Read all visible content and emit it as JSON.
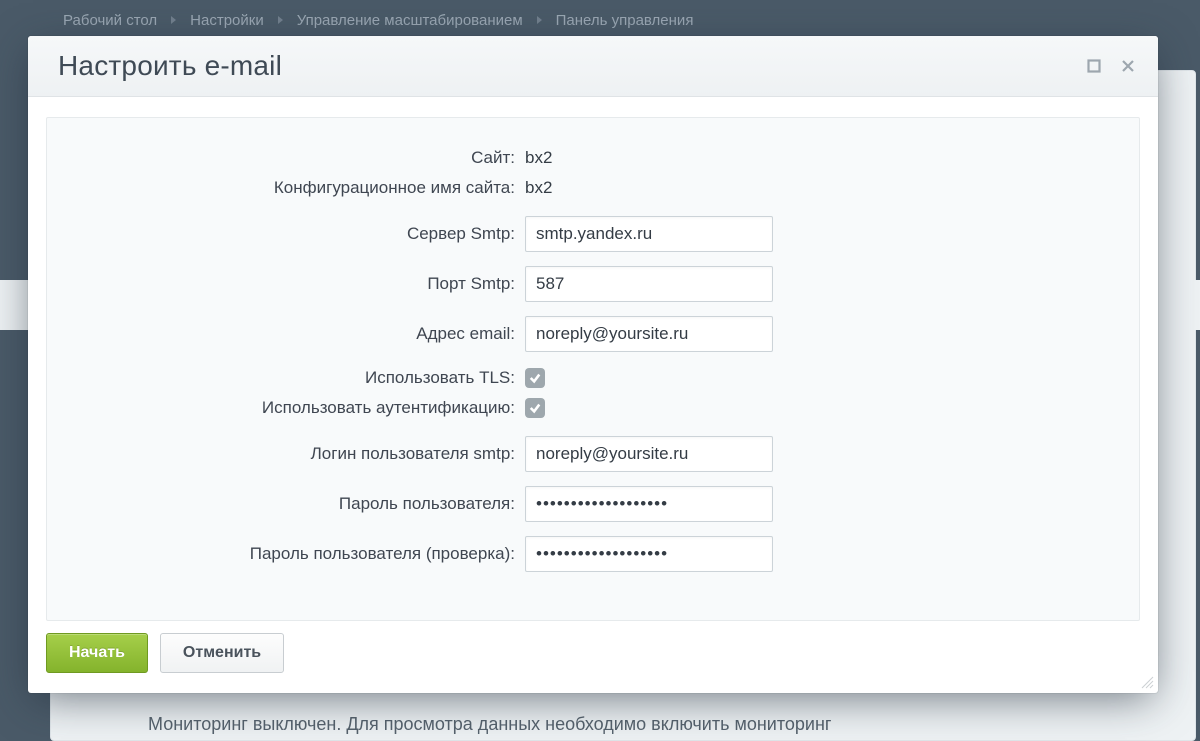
{
  "breadcrumb": [
    "Рабочий стол",
    "Настройки",
    "Управление масштабированием",
    "Панель управления"
  ],
  "background_note": "Мониторинг выключен. Для просмотра данных необходимо включить мониторинг",
  "dialog": {
    "title": "Настроить e-mail",
    "fields": {
      "site_label": "Сайт:",
      "site_value": "bx2",
      "config_name_label": "Конфигурационное имя сайта:",
      "config_name_value": "bx2",
      "smtp_server_label": "Сервер Smtp:",
      "smtp_server_value": "smtp.yandex.ru",
      "smtp_port_label": "Порт Smtp:",
      "smtp_port_value": "587",
      "email_label": "Адрес email:",
      "email_value": "noreply@yoursite.ru",
      "tls_label": "Использовать TLS:",
      "tls_checked": true,
      "auth_label": "Использовать аутентификацию:",
      "auth_checked": true,
      "login_label": "Логин пользователя smtp:",
      "login_value": "noreply@yoursite.ru",
      "password_label": "Пароль пользователя:",
      "password_value": "•••••••••••••••••••",
      "password_confirm_label": "Пароль пользователя (проверка):",
      "password_confirm_value": "•••••••••••••••••••"
    },
    "buttons": {
      "start": "Начать",
      "cancel": "Отменить"
    }
  }
}
